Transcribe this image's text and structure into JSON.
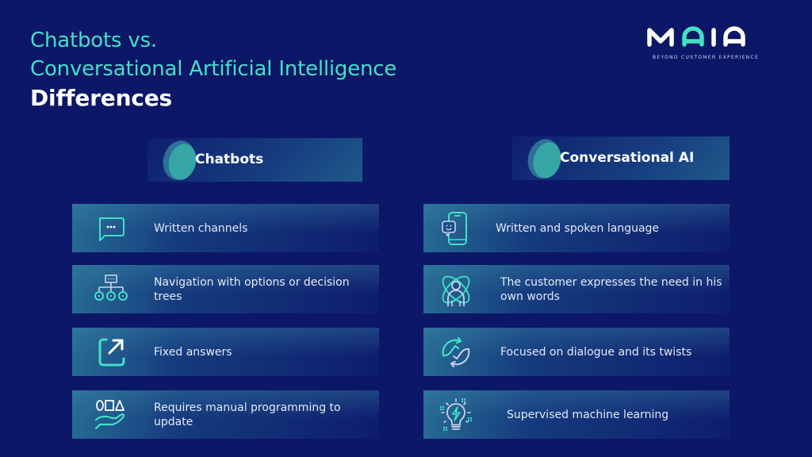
{
  "title": {
    "line1": "Chatbots vs.",
    "line2": "Conversational Artificial Intelligence",
    "line3": "Differences"
  },
  "logo": {
    "letters": [
      "M",
      "A",
      "I",
      "A"
    ],
    "tagline": "BEYOND CUSTOMER EXPERIENCE",
    "colors": {
      "primary": "#ffffff",
      "accent": "#43e0c4"
    }
  },
  "columns": [
    {
      "header": "Chatbots",
      "items": [
        {
          "icon": "chat-bubble-icon",
          "text": "Written channels"
        },
        {
          "icon": "decision-tree-icon",
          "text": "Navigation with options or decision trees"
        },
        {
          "icon": "external-arrow-icon",
          "text": "Fixed answers"
        },
        {
          "icon": "shapes-hand-icon",
          "text": "Requires manual programming to update"
        }
      ]
    },
    {
      "header": "Conversational AI",
      "items": [
        {
          "icon": "phone-chat-icon",
          "text": "Written and spoken language"
        },
        {
          "icon": "person-orbit-icon",
          "text": "The customer expresses the need in his own words"
        },
        {
          "icon": "refresh-arrows-icon",
          "text": "Focused on dialogue and its twists"
        },
        {
          "icon": "lightbulb-bolt-icon",
          "text": "Supervised machine learning"
        }
      ]
    }
  ],
  "colors": {
    "background": "#0c1767",
    "accent": "#43e0c4",
    "text": "#ffffff"
  }
}
